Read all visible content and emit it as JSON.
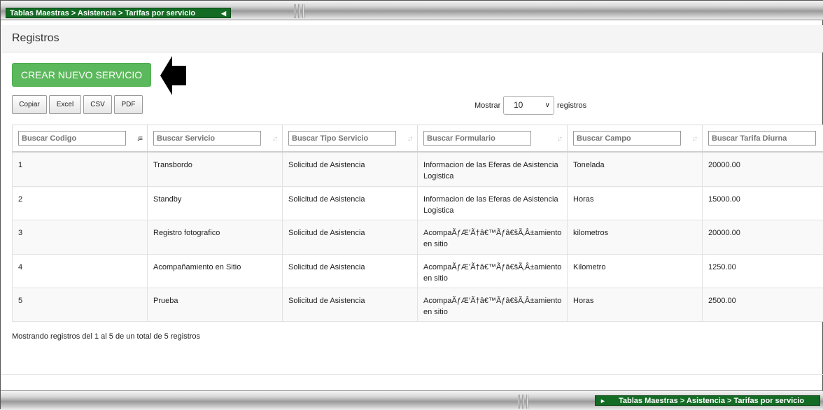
{
  "breadcrumb": "Tablas Maestras > Asistencia > Tarifas por servicio",
  "panel_title": "Registros",
  "create_button": "CREAR NUEVO SERVICIO",
  "export_buttons": [
    "Copiar",
    "Excel",
    "CSV",
    "PDF"
  ],
  "length": {
    "label_before": "Mostrar",
    "value": "10",
    "label_after": "registros"
  },
  "columns": [
    {
      "placeholder": "Buscar Codigo"
    },
    {
      "placeholder": "Buscar Servicio"
    },
    {
      "placeholder": "Buscar Tipo Servicio"
    },
    {
      "placeholder": "Buscar Formulario"
    },
    {
      "placeholder": "Buscar Campo"
    },
    {
      "placeholder": "Buscar Tarifa Diurna"
    }
  ],
  "rows": [
    [
      "1",
      "Transbordo",
      "Solicitud de Asistencia",
      "Informacion de las Eferas de Asistencia Logistica",
      "Tonelada",
      "20000.00"
    ],
    [
      "2",
      "Standby",
      "Solicitud de Asistencia",
      "Informacion de las Eferas de Asistencia Logistica",
      "Horas",
      "15000.00"
    ],
    [
      "3",
      "Registro fotografico",
      "Solicitud de Asistencia",
      "AcompaÃƒÆ’Ã†â€™Ãƒâ€šÃ‚Â±amiento en sitio",
      "kilometros",
      "20000.00"
    ],
    [
      "4",
      "Acompañamiento en Sitio",
      "Solicitud de Asistencia",
      "AcompaÃƒÆ’Ã†â€™Ãƒâ€šÃ‚Â±amiento en sitio",
      "Kilometro",
      "1250.00"
    ],
    [
      "5",
      "Prueba",
      "Solicitud de Asistencia",
      "AcompaÃƒÆ’Ã†â€™Ãƒâ€šÃ‚Â±amiento en sitio",
      "Horas",
      "2500.00"
    ]
  ],
  "info": "Mostrando registros del 1 al 5 de un total de 5 registros"
}
